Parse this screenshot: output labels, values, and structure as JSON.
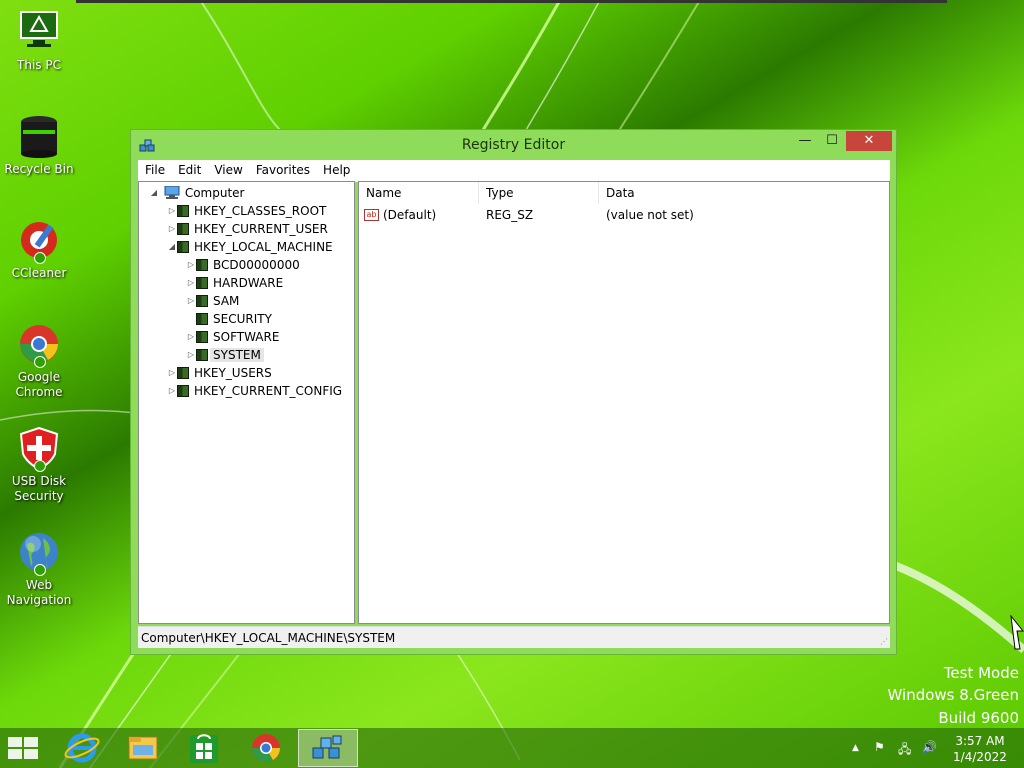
{
  "desktop": {
    "icons": [
      {
        "label": "This PC",
        "icon": "this-pc-icon"
      },
      {
        "label": "Recycle Bin",
        "icon": "recycle-bin-icon"
      },
      {
        "label": "CCleaner",
        "icon": "ccleaner-icon"
      },
      {
        "label": "Google Chrome",
        "icon": "chrome-icon"
      },
      {
        "label": "USB Disk Security",
        "icon": "shield-icon"
      },
      {
        "label": "Web Navigation",
        "icon": "globe-icon"
      }
    ],
    "watermark": {
      "line1": "Test Mode",
      "line2": "Windows 8.Green",
      "line3": "Build 9600"
    },
    "colors": {
      "accent": "#5fd000",
      "close_button": "#c7453b",
      "titlebar": "#8fdb5a"
    }
  },
  "window": {
    "title": "Registry Editor",
    "buttons": {
      "minimize": "—",
      "maximize": "☐",
      "close": "✕"
    },
    "menu": [
      "File",
      "Edit",
      "View",
      "Favorites",
      "Help"
    ],
    "tree": {
      "root": "Computer",
      "hives": [
        {
          "label": "HKEY_CLASSES_ROOT",
          "expander": "▷"
        },
        {
          "label": "HKEY_CURRENT_USER",
          "expander": "▷"
        },
        {
          "label": "HKEY_LOCAL_MACHINE",
          "expander": "◢"
        },
        {
          "label": "HKEY_USERS",
          "expander": "▷"
        },
        {
          "label": "HKEY_CURRENT_CONFIG",
          "expander": "▷"
        }
      ],
      "hklm_children": [
        {
          "label": "BCD00000000",
          "expander": "▷"
        },
        {
          "label": "HARDWARE",
          "expander": "▷"
        },
        {
          "label": "SAM",
          "expander": "▷"
        },
        {
          "label": "SECURITY",
          "expander": ""
        },
        {
          "label": "SOFTWARE",
          "expander": "▷"
        },
        {
          "label": "SYSTEM",
          "expander": "▷",
          "selected": true
        }
      ]
    },
    "columns": {
      "name": "Name",
      "type": "Type",
      "data": "Data"
    },
    "values": [
      {
        "name": "(Default)",
        "type": "REG_SZ",
        "data": "(value not set)",
        "icon": "ab"
      }
    ],
    "status": "Computer\\HKEY_LOCAL_MACHINE\\SYSTEM"
  },
  "taskbar": {
    "items": [
      {
        "icon": "start-icon"
      },
      {
        "icon": "internet-explorer-icon"
      },
      {
        "icon": "file-explorer-icon"
      },
      {
        "icon": "store-icon"
      },
      {
        "icon": "chrome-icon"
      },
      {
        "icon": "regedit-icon",
        "active": true
      }
    ],
    "tray": {
      "chevron": "▲",
      "flag": "⚑",
      "network": "🖧",
      "volume": "🔊"
    },
    "clock": {
      "time": "3:57 AM",
      "date": "1/4/2022"
    }
  }
}
